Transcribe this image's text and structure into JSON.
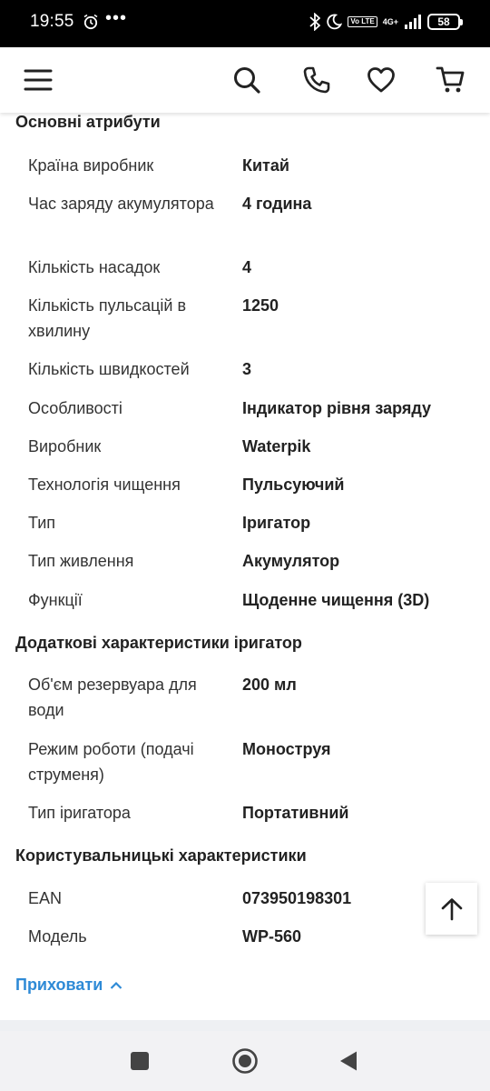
{
  "status_bar": {
    "time": "19:55",
    "more": "•••",
    "volte": "Vo LTE",
    "network": "4G+",
    "battery": "58"
  },
  "header": {
    "icons": [
      "menu-icon",
      "search-icon",
      "phone-icon",
      "heart-icon",
      "cart-icon"
    ]
  },
  "sections": [
    {
      "title": "Основні атрибути",
      "rows": [
        {
          "label": "Країна виробник",
          "value": "Китай"
        },
        {
          "label": "Час заряду акумулятора",
          "value": "4 година"
        },
        {
          "label": "Кількість насадок",
          "value": "4"
        },
        {
          "label": "Кількість пульсацій в хвилину",
          "value": "1250"
        },
        {
          "label": "Кількість швидкостей",
          "value": "3"
        },
        {
          "label": "Особливості",
          "value": "Індикатор рівня заряду"
        },
        {
          "label": "Виробник",
          "value": "Waterpik"
        },
        {
          "label": "Технологія чищення",
          "value": "Пульсуючий"
        },
        {
          "label": "Тип",
          "value": "Іригатор"
        },
        {
          "label": "Тип живлення",
          "value": "Акумулятор"
        },
        {
          "label": "Функції",
          "value": "Щоденне чищення (3D)"
        }
      ]
    },
    {
      "title": "Додаткові характеристики іригатор",
      "rows": [
        {
          "label": "Об'єм резервуара для води",
          "value": "200 мл"
        },
        {
          "label": "Режим роботи (подачі струменя)",
          "value": "Моноструя"
        },
        {
          "label": "Тип іригатора",
          "value": "Портативний"
        }
      ]
    },
    {
      "title": "Користувальницькі характеристики",
      "rows": [
        {
          "label": "EAN",
          "value": "073950198301"
        },
        {
          "label": "Модель",
          "value": "WP-560"
        }
      ]
    }
  ],
  "hide_link": "Приховати",
  "colors": {
    "accent": "#2e8ad6",
    "text": "#222222"
  }
}
